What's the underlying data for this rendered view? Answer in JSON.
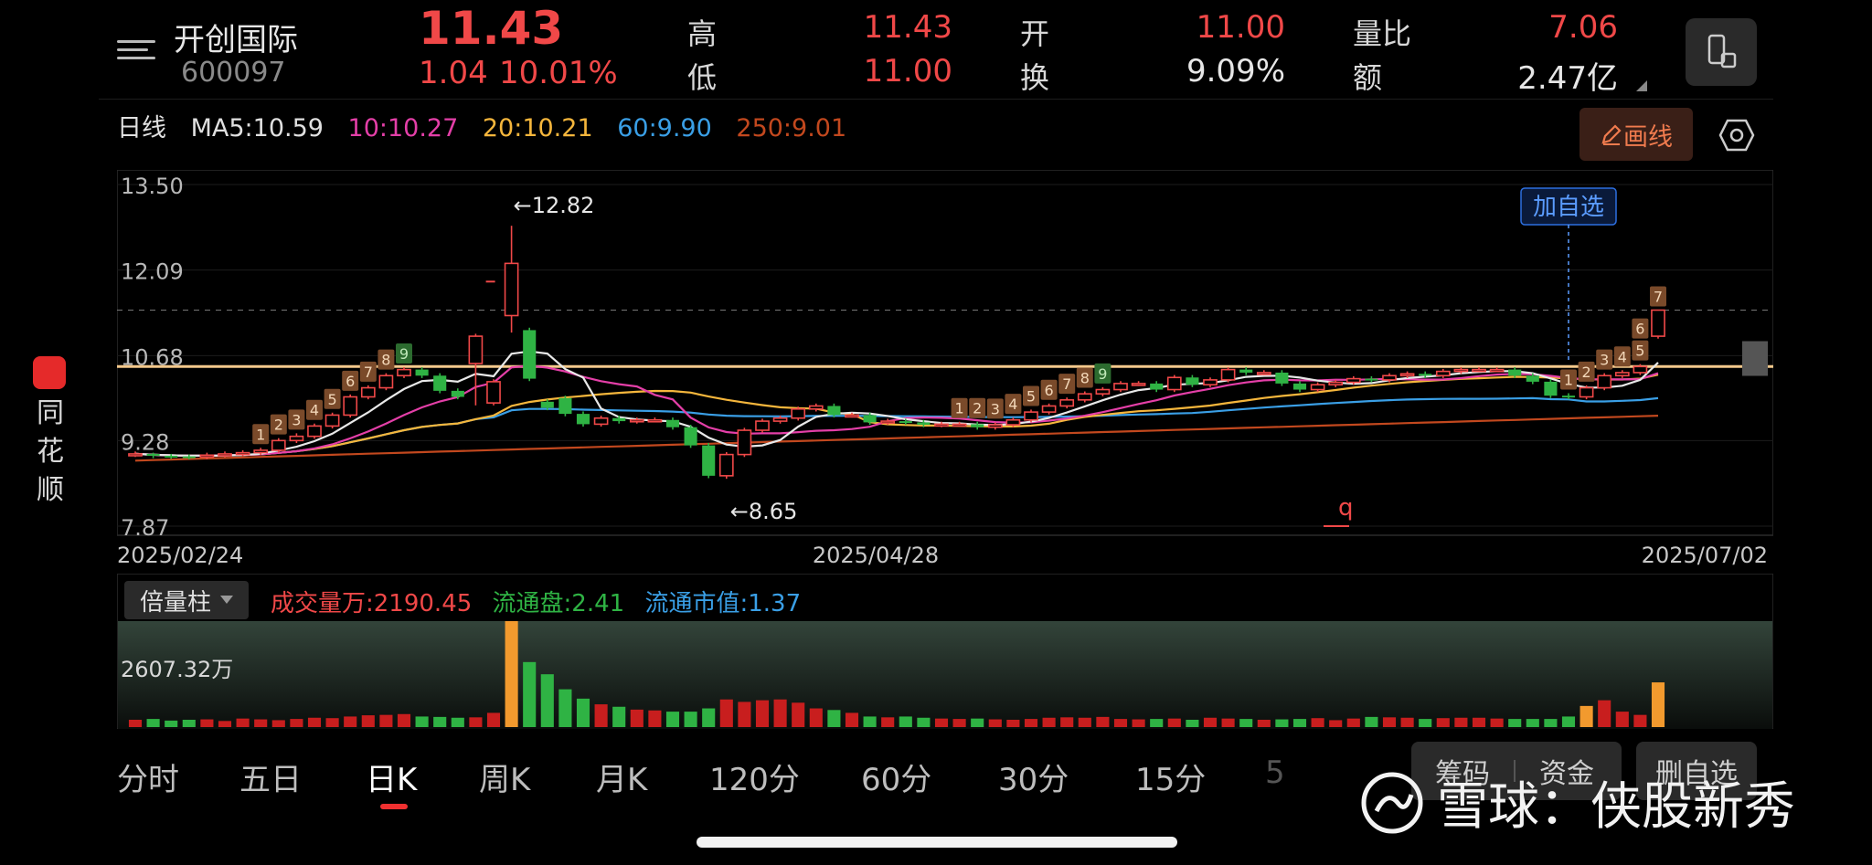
{
  "stock": {
    "name": "开创国际",
    "code": "600097",
    "price": "11.43",
    "change": "1.04",
    "change_pct": "10.01%"
  },
  "quote": {
    "high_label": "高",
    "high_value": "11.43",
    "low_label": "低",
    "low_value": "11.00",
    "open_label": "开",
    "open_value": "11.00",
    "turnover_label": "换",
    "turnover_value": "9.09%",
    "vol_ratio_label": "量比",
    "vol_ratio_value": "7.06",
    "amount_label": "额",
    "amount_value": "2.47亿"
  },
  "ma_legend": {
    "period": "日线",
    "ma5": "MA5:10.59",
    "ma10": "10:10.27",
    "ma20": "20:10.21",
    "ma60": "60:9.90",
    "ma250": "250:9.01"
  },
  "toolbar": {
    "draw_label": "画线"
  },
  "colors": {
    "up": "#f04848",
    "down": "#2fb344",
    "ma5": "#e8e8e8",
    "ma10": "#e43fa8",
    "ma20": "#f5b63c",
    "ma60": "#3a9fe6",
    "ma250": "#c2481e",
    "level_line": "#f4c98c"
  },
  "chart_data": {
    "type": "candlestick",
    "price_axis_labels": [
      "13.50",
      "12.09",
      "10.68",
      "9.28",
      "7.87"
    ],
    "ylim": [
      7.87,
      13.5
    ],
    "date_labels": [
      "2025/02/24",
      "2025/04/28",
      "2025/07/02"
    ],
    "high_annotation": "←12.82",
    "low_annotation": "←8.65",
    "add_watchlist_label": "加自选",
    "n_candles": 86,
    "open": [
      9.05,
      9.06,
      9.03,
      9.02,
      9.01,
      9.04,
      9.06,
      9.08,
      9.12,
      9.28,
      9.35,
      9.52,
      9.7,
      10.0,
      10.15,
      10.35,
      10.45,
      10.35,
      10.1,
      10.55,
      9.9,
      11.34,
      11.1,
      9.92,
      9.98,
      9.72,
      9.55,
      9.65,
      9.6,
      9.62,
      9.62,
      9.5,
      9.2,
      8.7,
      9.05,
      9.45,
      9.6,
      9.65,
      9.8,
      9.85,
      9.7,
      9.7,
      9.58,
      9.6,
      9.58,
      9.54,
      9.55,
      9.55,
      9.5,
      9.54,
      9.62,
      9.75,
      9.85,
      9.95,
      10.05,
      10.12,
      10.22,
      10.22,
      10.12,
      10.32,
      10.2,
      10.28,
      10.45,
      10.4,
      10.4,
      10.22,
      10.12,
      10.2,
      10.24,
      10.3,
      10.28,
      10.35,
      10.38,
      10.35,
      10.42,
      10.45,
      10.45,
      10.45,
      10.35,
      10.25,
      10.02,
      10.0,
      10.15,
      10.35,
      10.4,
      11.0
    ],
    "close": [
      9.06,
      9.03,
      9.02,
      9.01,
      9.04,
      9.06,
      9.08,
      9.12,
      9.28,
      9.35,
      9.52,
      9.7,
      10.0,
      10.15,
      10.35,
      10.45,
      10.35,
      10.1,
      10.0,
      11.0,
      10.25,
      12.2,
      10.3,
      9.82,
      9.72,
      9.55,
      9.65,
      9.6,
      9.62,
      9.62,
      9.5,
      9.2,
      8.7,
      9.05,
      9.45,
      9.6,
      9.65,
      9.8,
      9.85,
      9.7,
      9.7,
      9.58,
      9.6,
      9.58,
      9.54,
      9.55,
      9.55,
      9.5,
      9.54,
      9.62,
      9.75,
      9.85,
      9.95,
      10.05,
      10.12,
      10.22,
      10.22,
      10.12,
      10.32,
      10.2,
      10.28,
      10.45,
      10.4,
      10.4,
      10.22,
      10.12,
      10.2,
      10.24,
      10.3,
      10.28,
      10.35,
      10.38,
      10.35,
      10.42,
      10.45,
      10.45,
      10.45,
      10.35,
      10.25,
      10.02,
      10.0,
      10.15,
      10.35,
      10.4,
      10.5,
      11.43
    ],
    "high": [
      9.1,
      9.08,
      9.06,
      9.05,
      9.08,
      9.1,
      9.12,
      9.16,
      9.32,
      9.4,
      9.56,
      9.74,
      10.04,
      10.19,
      10.39,
      10.49,
      10.49,
      10.39,
      10.14,
      11.04,
      10.29,
      12.82,
      11.14,
      9.96,
      10.02,
      9.76,
      9.69,
      9.69,
      9.66,
      9.66,
      9.66,
      9.54,
      9.24,
      9.09,
      9.49,
      9.64,
      9.69,
      9.84,
      9.89,
      9.89,
      9.74,
      9.74,
      9.64,
      9.64,
      9.62,
      9.59,
      9.59,
      9.59,
      9.58,
      9.66,
      9.79,
      9.89,
      9.99,
      10.09,
      10.16,
      10.26,
      10.26,
      10.26,
      10.36,
      10.36,
      10.32,
      10.49,
      10.49,
      10.44,
      10.44,
      10.26,
      10.24,
      10.28,
      10.34,
      10.34,
      10.39,
      10.42,
      10.42,
      10.46,
      10.49,
      10.49,
      10.49,
      10.49,
      10.39,
      10.29,
      10.06,
      10.19,
      10.39,
      10.44,
      10.54,
      11.43
    ],
    "low": [
      9.01,
      8.99,
      8.98,
      8.97,
      8.97,
      9.0,
      9.02,
      9.04,
      9.08,
      9.24,
      9.31,
      9.48,
      9.66,
      9.96,
      10.11,
      10.31,
      10.31,
      10.06,
      9.96,
      9.86,
      9.86,
      11.06,
      10.26,
      9.78,
      9.68,
      9.51,
      9.51,
      9.56,
      9.56,
      9.58,
      9.46,
      9.16,
      8.66,
      8.65,
      9.01,
      9.41,
      9.56,
      9.61,
      9.76,
      9.66,
      9.66,
      9.54,
      9.54,
      9.54,
      9.5,
      9.5,
      9.51,
      9.46,
      9.46,
      9.5,
      9.58,
      9.71,
      9.81,
      9.91,
      10.01,
      10.08,
      10.18,
      10.08,
      10.08,
      10.16,
      10.16,
      10.24,
      10.36,
      10.36,
      10.18,
      10.08,
      10.08,
      10.16,
      10.2,
      10.24,
      10.24,
      10.31,
      10.31,
      10.31,
      10.38,
      10.41,
      10.41,
      10.31,
      10.21,
      9.98,
      9.96,
      9.96,
      10.11,
      10.31,
      10.36,
      10.96
    ],
    "td_marks": [
      {
        "i": 7,
        "label": "1",
        "pos": "above"
      },
      {
        "i": 8,
        "label": "2",
        "pos": "above"
      },
      {
        "i": 9,
        "label": "3",
        "pos": "above"
      },
      {
        "i": 10,
        "label": "4",
        "pos": "above"
      },
      {
        "i": 11,
        "label": "5",
        "pos": "above"
      },
      {
        "i": 12,
        "label": "6",
        "pos": "above"
      },
      {
        "i": 13,
        "label": "7",
        "pos": "above"
      },
      {
        "i": 14,
        "label": "8",
        "pos": "above"
      },
      {
        "i": 15,
        "label": "9",
        "pos": "above"
      },
      {
        "i": 46,
        "label": "1",
        "pos": "above"
      },
      {
        "i": 47,
        "label": "2",
        "pos": "above"
      },
      {
        "i": 48,
        "label": "3",
        "pos": "above"
      },
      {
        "i": 49,
        "label": "4",
        "pos": "above"
      },
      {
        "i": 50,
        "label": "5",
        "pos": "above"
      },
      {
        "i": 51,
        "label": "6",
        "pos": "above"
      },
      {
        "i": 52,
        "label": "7",
        "pos": "above"
      },
      {
        "i": 53,
        "label": "8",
        "pos": "above"
      },
      {
        "i": 54,
        "label": "9",
        "pos": "above"
      },
      {
        "i": 80,
        "label": "1",
        "pos": "above"
      },
      {
        "i": 81,
        "label": "2",
        "pos": "above"
      },
      {
        "i": 82,
        "label": "3",
        "pos": "above"
      },
      {
        "i": 83,
        "label": "4",
        "pos": "above"
      },
      {
        "i": 84,
        "label": "5",
        "pos": "above"
      },
      {
        "i": 84,
        "label": "6",
        "pos": "above"
      },
      {
        "i": 85,
        "label": "7",
        "pos": "above"
      }
    ],
    "volume_type_label": "倍量柱",
    "volume_label": "成交量万:2190.45",
    "float_shares_label": "流通盘:2.41",
    "float_mcap_label": "流通市值:1.37",
    "volume_axis_label": "2607.32万",
    "volume_ylim": [
      0,
      2607.32
    ],
    "volume": [
      180,
      200,
      160,
      180,
      190,
      150,
      210,
      190,
      170,
      200,
      230,
      220,
      260,
      290,
      300,
      320,
      260,
      250,
      230,
      240,
      350,
      2607,
      1600,
      1300,
      930,
      700,
      560,
      500,
      430,
      410,
      380,
      380,
      460,
      680,
      620,
      660,
      680,
      600,
      460,
      420,
      350,
      260,
      240,
      260,
      230,
      210,
      200,
      210,
      190,
      180,
      200,
      230,
      240,
      230,
      250,
      200,
      190,
      200,
      210,
      180,
      230,
      210,
      200,
      180,
      190,
      200,
      220,
      170,
      210,
      250,
      240,
      230,
      200,
      220,
      230,
      230,
      210,
      200,
      200,
      200,
      260,
      520,
      660,
      380,
      300,
      1100
    ]
  },
  "tabs": [
    "分时",
    "五日",
    "日K",
    "周K",
    "月K",
    "120分",
    "60分",
    "30分",
    "15分",
    "5"
  ],
  "active_tab": "日K",
  "bottom_buttons": {
    "chips": "筹码",
    "funds": "资金",
    "remove": "删自选"
  },
  "watermark": "雪球：侠股新秀",
  "brand": "同花顺"
}
